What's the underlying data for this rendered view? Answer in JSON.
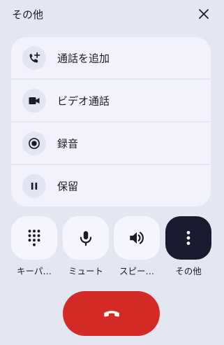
{
  "header": {
    "title": "その他",
    "close_icon": "close-icon"
  },
  "menu": {
    "items": [
      {
        "label": "通話を追加",
        "icon": "add-call-icon"
      },
      {
        "label": "ビデオ通話",
        "icon": "video-camera-icon"
      },
      {
        "label": "録音",
        "icon": "record-icon"
      },
      {
        "label": "保留",
        "icon": "pause-icon"
      }
    ]
  },
  "controls": {
    "items": [
      {
        "label": "キーパ…",
        "icon": "dialpad-icon",
        "active": false
      },
      {
        "label": "ミュート",
        "icon": "microphone-icon",
        "active": false
      },
      {
        "label": "スピー…",
        "icon": "speaker-icon",
        "active": false
      },
      {
        "label": "その他",
        "icon": "more-vertical-icon",
        "active": true
      }
    ]
  },
  "end_call": {
    "icon": "end-call-icon",
    "color": "#d32a25"
  },
  "colors": {
    "background": "#e4e6f2",
    "menu_surface": "#f1f2fb",
    "active_button": "#181b2e",
    "end_call": "#d32a25"
  }
}
